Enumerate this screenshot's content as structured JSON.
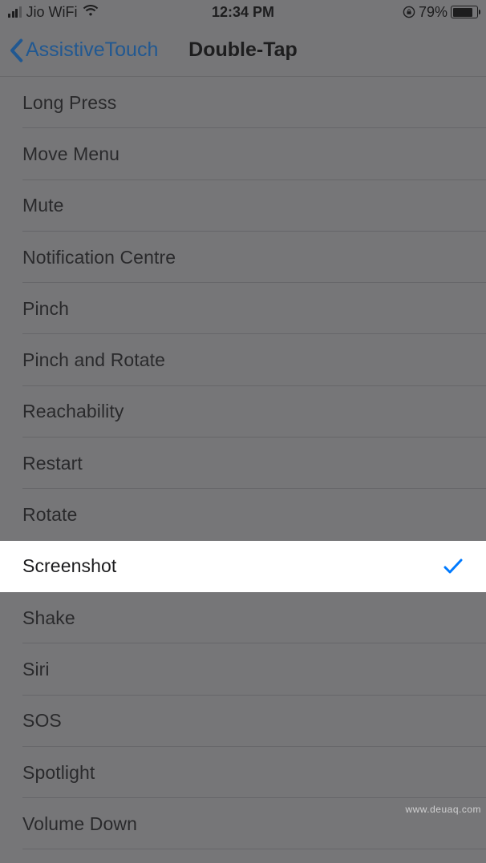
{
  "status_bar": {
    "carrier": "Jio WiFi",
    "time": "12:34 PM",
    "battery_percent": "79%"
  },
  "nav": {
    "back_label": "AssistiveTouch",
    "title": "Double-Tap"
  },
  "options": [
    {
      "label": "Long Press",
      "selected": false
    },
    {
      "label": "Move Menu",
      "selected": false
    },
    {
      "label": "Mute",
      "selected": false
    },
    {
      "label": "Notification Centre",
      "selected": false
    },
    {
      "label": "Pinch",
      "selected": false
    },
    {
      "label": "Pinch and Rotate",
      "selected": false
    },
    {
      "label": "Reachability",
      "selected": false
    },
    {
      "label": "Restart",
      "selected": false
    },
    {
      "label": "Rotate",
      "selected": false
    },
    {
      "label": "Screenshot",
      "selected": true
    },
    {
      "label": "Shake",
      "selected": false
    },
    {
      "label": "Siri",
      "selected": false
    },
    {
      "label": "SOS",
      "selected": false
    },
    {
      "label": "Spotlight",
      "selected": false
    },
    {
      "label": "Volume Down",
      "selected": false
    }
  ],
  "watermark": "www.deuaq.com"
}
